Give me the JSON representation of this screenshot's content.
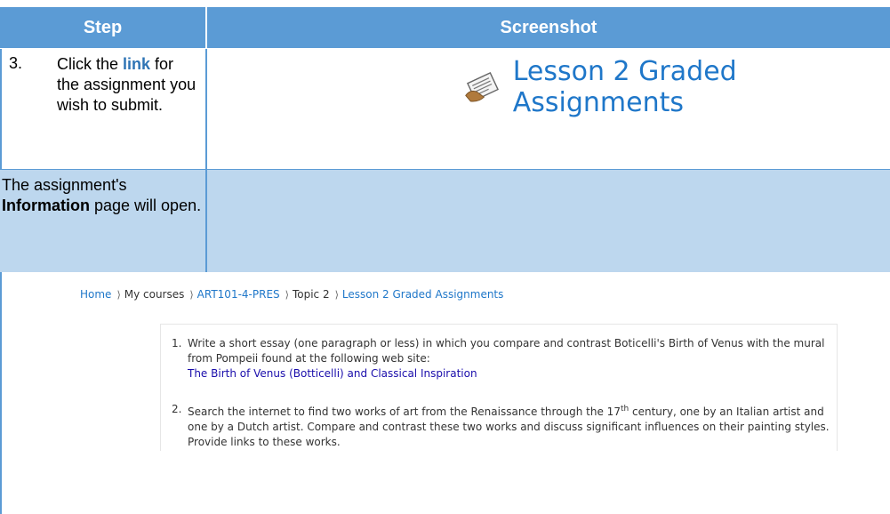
{
  "table": {
    "header_step": "Step",
    "header_screenshot": "Screenshot"
  },
  "step3": {
    "number": "3.",
    "text_before": "Click the ",
    "link_word": "link",
    "text_after": " for the assignment you wish to submit."
  },
  "lesson_link": {
    "icon": "assignment-icon",
    "title": "Lesson 2 Graded Assignments"
  },
  "info_row": {
    "text_before": "The assignment's ",
    "bold": "Information",
    "text_after": " page will open."
  },
  "breadcrumb": {
    "home": "Home",
    "my_courses": "My courses",
    "course": "ART101-4-PRES",
    "topic": "Topic 2",
    "lesson": "Lesson 2 Graded Assignments",
    "separator": "⟩"
  },
  "assignment": {
    "item1_num": "1.",
    "item1_text": "Write a short essay (one paragraph or less) in which you compare and contrast Boticelli's Birth of Venus with the mural from Pompeii found at the following web site:",
    "item1_link": "The Birth of Venus (Botticelli) and Classical Inspiration",
    "item2_num": "2.",
    "item2_text_a": "Search the internet to find two works of art from the Renaissance through the 17",
    "item2_sup": "th",
    "item2_text_b": " century, one by an Italian artist and one by a Dutch artist. Compare and contrast these two works and discuss significant influences on their painting styles. Provide links to these works."
  },
  "colors": {
    "header_blue": "#5b9bd5",
    "light_blue_row": "#bdd7ee",
    "link_blue": "#1f77c9"
  }
}
